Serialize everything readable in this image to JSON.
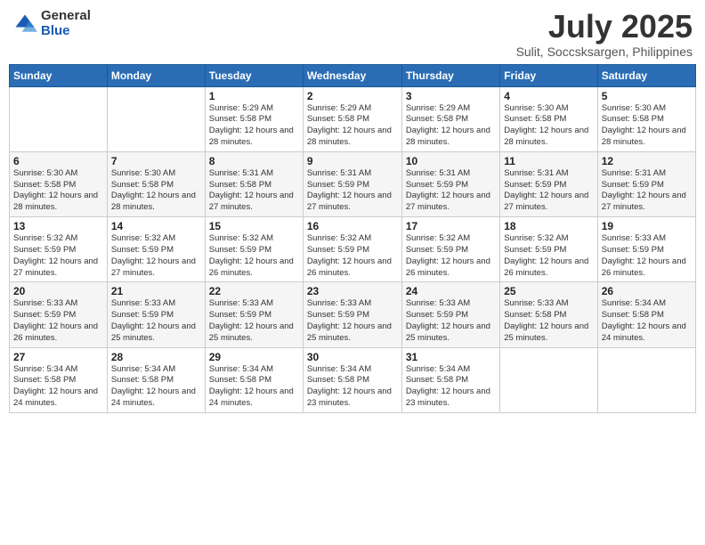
{
  "header": {
    "logo_general": "General",
    "logo_blue": "Blue",
    "main_title": "July 2025",
    "subtitle": "Sulit, Soccsksargen, Philippines"
  },
  "weekdays": [
    "Sunday",
    "Monday",
    "Tuesday",
    "Wednesday",
    "Thursday",
    "Friday",
    "Saturday"
  ],
  "weeks": [
    [
      {
        "day": "",
        "info": ""
      },
      {
        "day": "",
        "info": ""
      },
      {
        "day": "1",
        "info": "Sunrise: 5:29 AM\nSunset: 5:58 PM\nDaylight: 12 hours and 28 minutes."
      },
      {
        "day": "2",
        "info": "Sunrise: 5:29 AM\nSunset: 5:58 PM\nDaylight: 12 hours and 28 minutes."
      },
      {
        "day": "3",
        "info": "Sunrise: 5:29 AM\nSunset: 5:58 PM\nDaylight: 12 hours and 28 minutes."
      },
      {
        "day": "4",
        "info": "Sunrise: 5:30 AM\nSunset: 5:58 PM\nDaylight: 12 hours and 28 minutes."
      },
      {
        "day": "5",
        "info": "Sunrise: 5:30 AM\nSunset: 5:58 PM\nDaylight: 12 hours and 28 minutes."
      }
    ],
    [
      {
        "day": "6",
        "info": "Sunrise: 5:30 AM\nSunset: 5:58 PM\nDaylight: 12 hours and 28 minutes."
      },
      {
        "day": "7",
        "info": "Sunrise: 5:30 AM\nSunset: 5:58 PM\nDaylight: 12 hours and 28 minutes."
      },
      {
        "day": "8",
        "info": "Sunrise: 5:31 AM\nSunset: 5:58 PM\nDaylight: 12 hours and 27 minutes."
      },
      {
        "day": "9",
        "info": "Sunrise: 5:31 AM\nSunset: 5:59 PM\nDaylight: 12 hours and 27 minutes."
      },
      {
        "day": "10",
        "info": "Sunrise: 5:31 AM\nSunset: 5:59 PM\nDaylight: 12 hours and 27 minutes."
      },
      {
        "day": "11",
        "info": "Sunrise: 5:31 AM\nSunset: 5:59 PM\nDaylight: 12 hours and 27 minutes."
      },
      {
        "day": "12",
        "info": "Sunrise: 5:31 AM\nSunset: 5:59 PM\nDaylight: 12 hours and 27 minutes."
      }
    ],
    [
      {
        "day": "13",
        "info": "Sunrise: 5:32 AM\nSunset: 5:59 PM\nDaylight: 12 hours and 27 minutes."
      },
      {
        "day": "14",
        "info": "Sunrise: 5:32 AM\nSunset: 5:59 PM\nDaylight: 12 hours and 27 minutes."
      },
      {
        "day": "15",
        "info": "Sunrise: 5:32 AM\nSunset: 5:59 PM\nDaylight: 12 hours and 26 minutes."
      },
      {
        "day": "16",
        "info": "Sunrise: 5:32 AM\nSunset: 5:59 PM\nDaylight: 12 hours and 26 minutes."
      },
      {
        "day": "17",
        "info": "Sunrise: 5:32 AM\nSunset: 5:59 PM\nDaylight: 12 hours and 26 minutes."
      },
      {
        "day": "18",
        "info": "Sunrise: 5:32 AM\nSunset: 5:59 PM\nDaylight: 12 hours and 26 minutes."
      },
      {
        "day": "19",
        "info": "Sunrise: 5:33 AM\nSunset: 5:59 PM\nDaylight: 12 hours and 26 minutes."
      }
    ],
    [
      {
        "day": "20",
        "info": "Sunrise: 5:33 AM\nSunset: 5:59 PM\nDaylight: 12 hours and 26 minutes."
      },
      {
        "day": "21",
        "info": "Sunrise: 5:33 AM\nSunset: 5:59 PM\nDaylight: 12 hours and 25 minutes."
      },
      {
        "day": "22",
        "info": "Sunrise: 5:33 AM\nSunset: 5:59 PM\nDaylight: 12 hours and 25 minutes."
      },
      {
        "day": "23",
        "info": "Sunrise: 5:33 AM\nSunset: 5:59 PM\nDaylight: 12 hours and 25 minutes."
      },
      {
        "day": "24",
        "info": "Sunrise: 5:33 AM\nSunset: 5:59 PM\nDaylight: 12 hours and 25 minutes."
      },
      {
        "day": "25",
        "info": "Sunrise: 5:33 AM\nSunset: 5:58 PM\nDaylight: 12 hours and 25 minutes."
      },
      {
        "day": "26",
        "info": "Sunrise: 5:34 AM\nSunset: 5:58 PM\nDaylight: 12 hours and 24 minutes."
      }
    ],
    [
      {
        "day": "27",
        "info": "Sunrise: 5:34 AM\nSunset: 5:58 PM\nDaylight: 12 hours and 24 minutes."
      },
      {
        "day": "28",
        "info": "Sunrise: 5:34 AM\nSunset: 5:58 PM\nDaylight: 12 hours and 24 minutes."
      },
      {
        "day": "29",
        "info": "Sunrise: 5:34 AM\nSunset: 5:58 PM\nDaylight: 12 hours and 24 minutes."
      },
      {
        "day": "30",
        "info": "Sunrise: 5:34 AM\nSunset: 5:58 PM\nDaylight: 12 hours and 23 minutes."
      },
      {
        "day": "31",
        "info": "Sunrise: 5:34 AM\nSunset: 5:58 PM\nDaylight: 12 hours and 23 minutes."
      },
      {
        "day": "",
        "info": ""
      },
      {
        "day": "",
        "info": ""
      }
    ]
  ]
}
